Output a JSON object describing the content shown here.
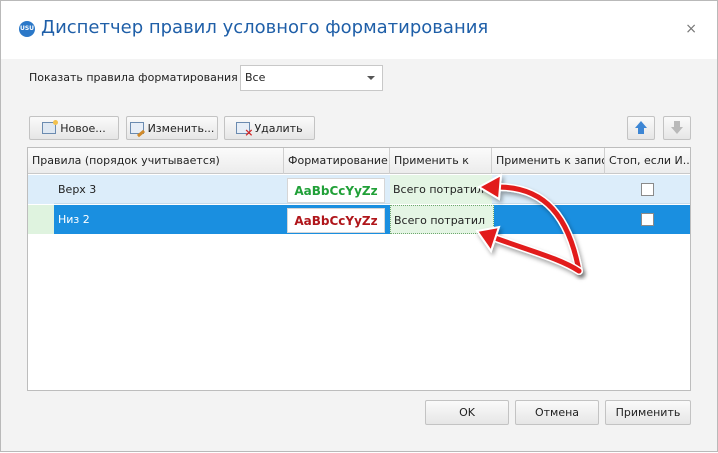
{
  "window": {
    "title": "Диспетчер правил условного форматирования",
    "app_icon_text": "USU",
    "close_glyph": "×"
  },
  "filter": {
    "label": "Показать правила форматирования для:",
    "selected": "Все"
  },
  "toolbar": {
    "new_label": "Новое...",
    "edit_label": "Изменить...",
    "delete_label": "Удалить"
  },
  "grid": {
    "columns": [
      "Правила (порядок учитывается)",
      "Форматирование",
      "Применить к",
      "Применить к записи",
      "Стоп, если И..."
    ],
    "rows": [
      {
        "rule": "Верх 3",
        "format_sample": "AaBbCcYyZz",
        "format_color": "#21a038",
        "apply_to": "Всего потратил",
        "apply_to_record": "",
        "stop": false
      },
      {
        "rule": "Низ 2",
        "format_sample": "AaBbCcYyZz",
        "format_color": "#b0161b",
        "apply_to": "Всего потратил",
        "apply_to_record": "",
        "stop": false
      }
    ]
  },
  "footer": {
    "ok_label": "OK",
    "cancel_label": "Отмена",
    "apply_label": "Применить"
  },
  "colors": {
    "title": "#1f5fa8",
    "selected_row": "#1a8fe0",
    "annotation_arrow": "#e21b1b"
  }
}
